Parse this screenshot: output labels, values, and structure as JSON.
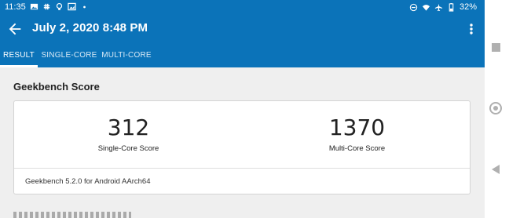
{
  "status_bar": {
    "time": "11:35",
    "battery": "32%",
    "left_icons": [
      "image-icon",
      "slack-icon",
      "bulb-icon",
      "photo-icon",
      "dot-icon"
    ],
    "right_icons": [
      "do-not-disturb-icon",
      "wifi-icon",
      "airplane-icon",
      "battery-icon"
    ]
  },
  "app_bar": {
    "title": "July 2, 2020 8:48 PM",
    "back_icon": "arrow-left-icon",
    "menu_icon": "more-vert-icon"
  },
  "tabs": [
    {
      "label": "RESULT",
      "active": true
    },
    {
      "label": "SINGLE-CORE",
      "active": false
    },
    {
      "label": "MULTI-CORE",
      "active": false
    }
  ],
  "main": {
    "section_title": "Geekbench Score",
    "single_core": {
      "value": "312",
      "label": "Single-Core Score"
    },
    "multi_core": {
      "value": "1370",
      "label": "Multi-Core Score"
    },
    "version": "Geekbench 5.2.0 for Android AArch64"
  },
  "colors": {
    "primary": "#0b73b9",
    "background": "#efefef",
    "card": "#ffffff"
  },
  "navigation_bar": {
    "icons": [
      "recents-square-icon",
      "home-circle-icon",
      "back-triangle-icon"
    ]
  }
}
